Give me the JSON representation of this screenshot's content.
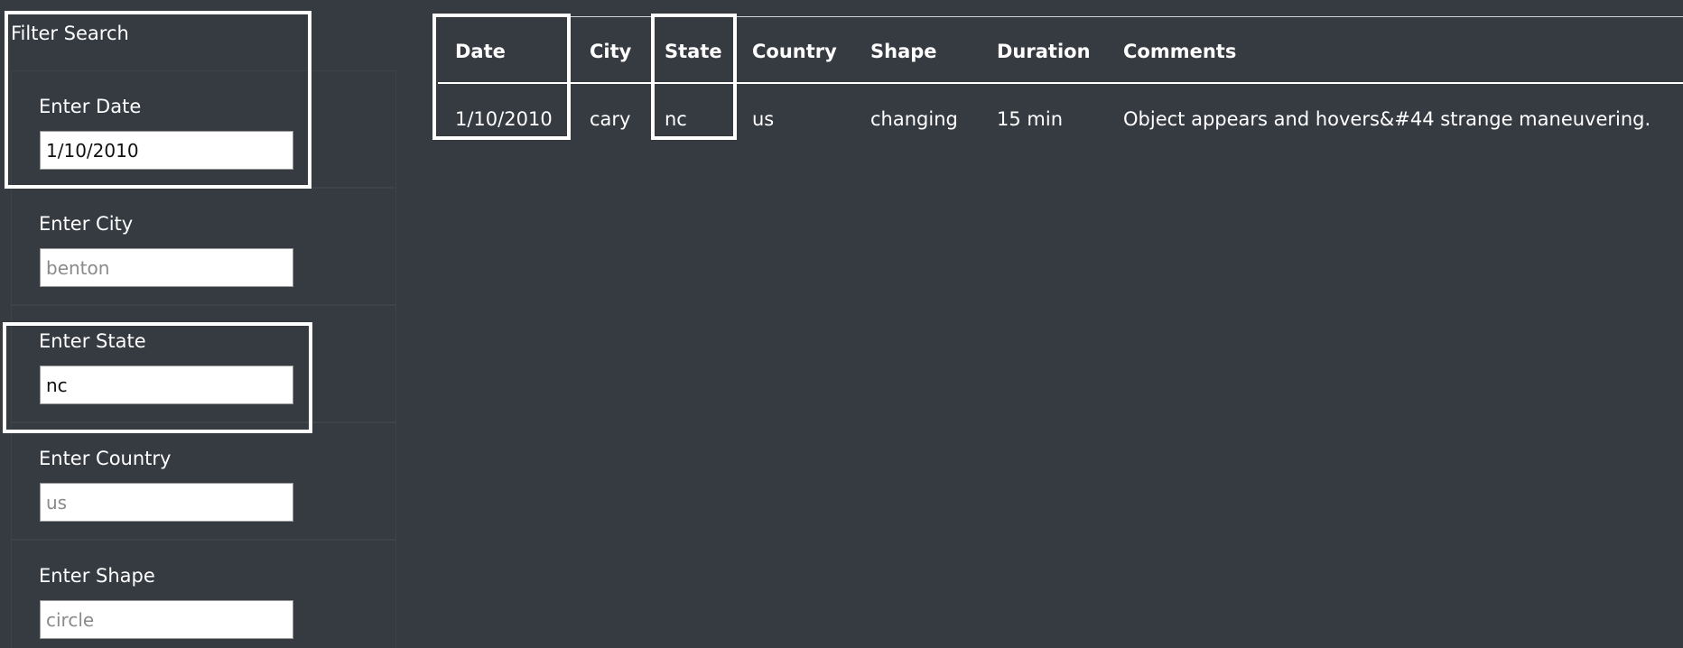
{
  "filter": {
    "title": "Filter Search",
    "fields": [
      {
        "label": "Enter Date",
        "value": "1/10/2010",
        "placeholder": ""
      },
      {
        "label": "Enter City",
        "value": "",
        "placeholder": "benton"
      },
      {
        "label": "Enter State",
        "value": "nc",
        "placeholder": ""
      },
      {
        "label": "Enter Country",
        "value": "",
        "placeholder": "us"
      },
      {
        "label": "Enter Shape",
        "value": "",
        "placeholder": "circle"
      }
    ]
  },
  "table": {
    "columns": [
      "Date",
      "City",
      "State",
      "Country",
      "Shape",
      "Duration",
      "Comments"
    ],
    "rows": [
      [
        "1/10/2010",
        "cary",
        "nc",
        "us",
        "changing",
        "15 min",
        "Object appears and hovers&#44 strange maneuvering."
      ]
    ]
  },
  "colors": {
    "background": "#363a41",
    "text": "#ffffff",
    "highlight_border": "#ffffff",
    "input_background": "#ffffff"
  }
}
